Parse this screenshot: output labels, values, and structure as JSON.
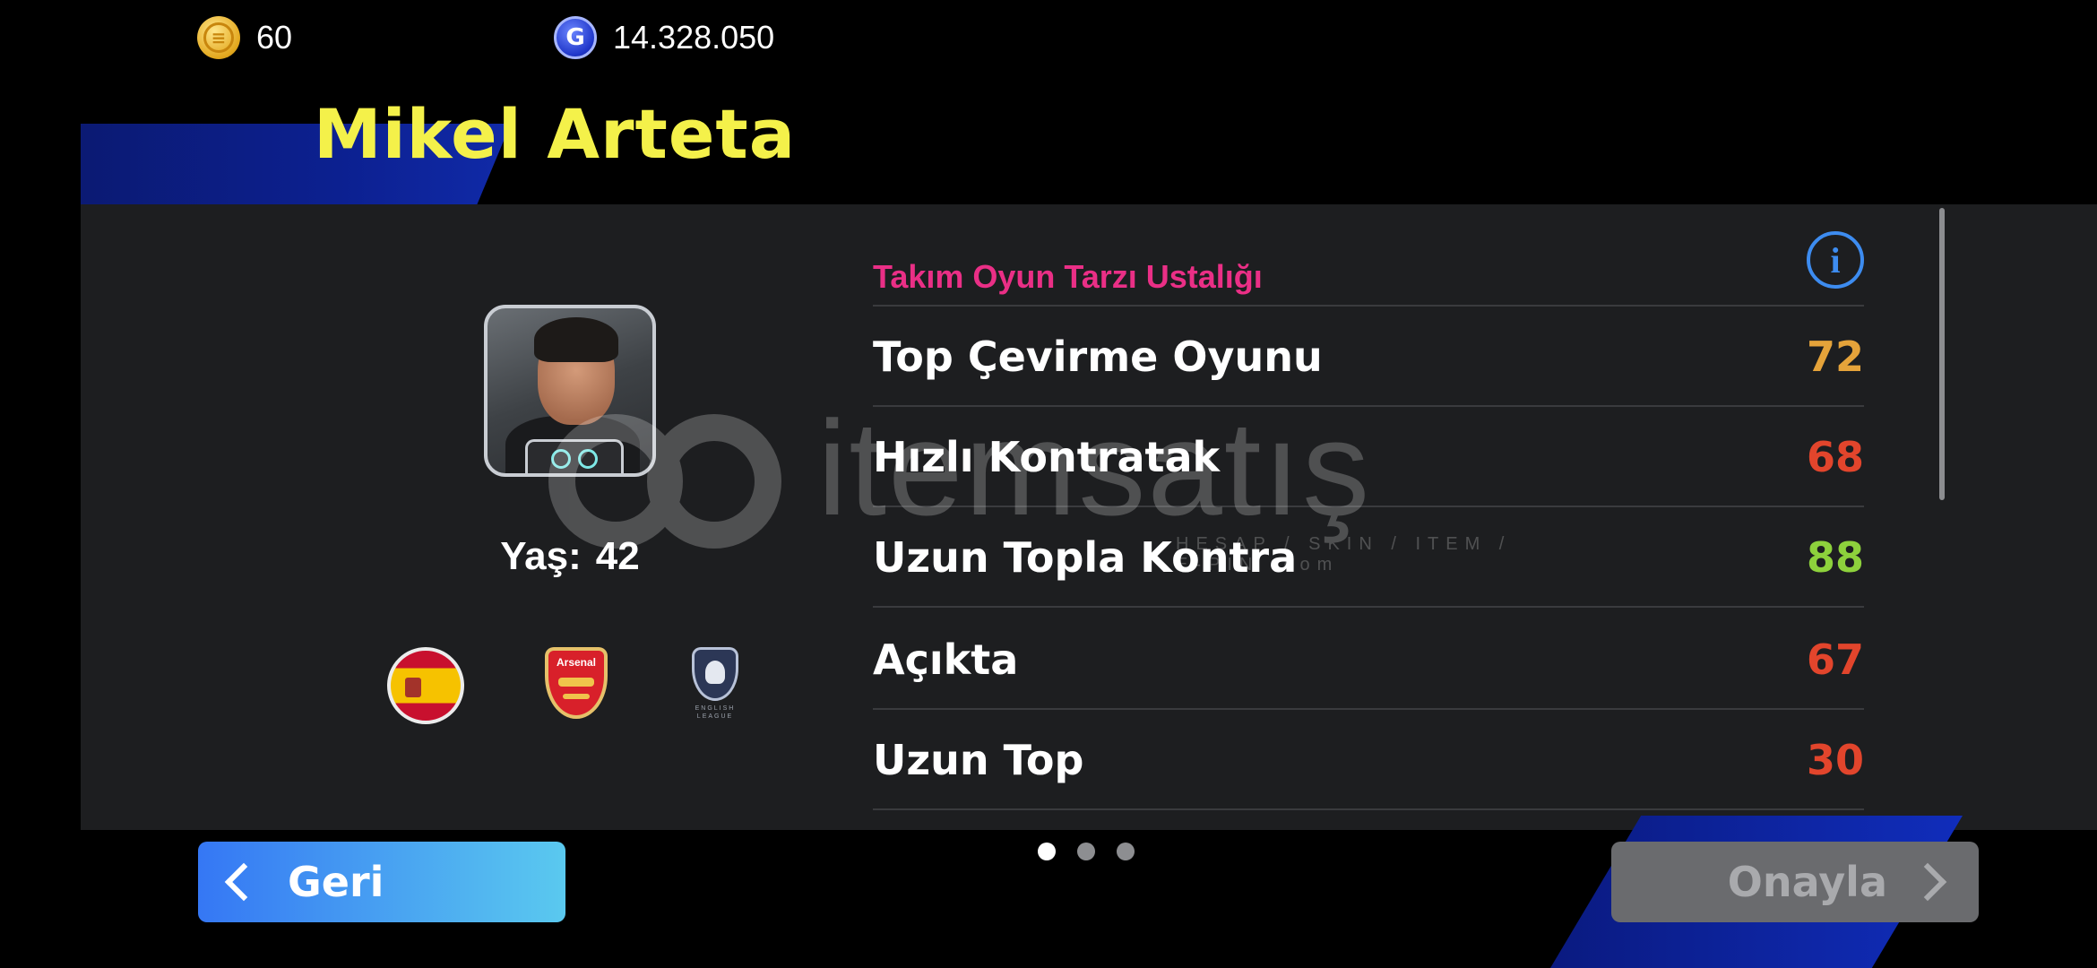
{
  "currency": {
    "coins": "60",
    "gp": "14.328.050",
    "coin_icon": "efootball-coin-icon",
    "gp_icon": "gp-coin-icon",
    "gp_glyph": "G"
  },
  "coach": {
    "name": "Mikel Arteta"
  },
  "profile": {
    "age_label": "Yaş:",
    "age_value": "42",
    "arsenal_text": "Arsenal",
    "league_text": "ENGLISH LEAGUE"
  },
  "stats": {
    "title": "Takım Oyun Tarzı Ustalığı",
    "info_glyph": "i",
    "rows": [
      {
        "name": "Top Çevirme Oyunu",
        "value": "72",
        "color": "#e5a33a"
      },
      {
        "name": "Hızlı Kontratak",
        "value": "68",
        "color": "#e2452c"
      },
      {
        "name": "Uzun Topla Kontra",
        "value": "88",
        "color": "#8dd13c"
      },
      {
        "name": "Açıkta",
        "value": "67",
        "color": "#e2452c"
      },
      {
        "name": "Uzun Top",
        "value": "30",
        "color": "#e2452c"
      }
    ]
  },
  "watermark": {
    "word": "itemsatış",
    "sub": "HESAP / SKIN / ITEM / E-PIN .com"
  },
  "pager": {
    "total": 3,
    "active": 1
  },
  "buttons": {
    "back_label": "Geri",
    "confirm_label": "Onayla"
  },
  "colors": {
    "accent_yellow": "#f4f14a",
    "title_pink": "#ea2f86",
    "panel_bg": "#1d1e20"
  }
}
